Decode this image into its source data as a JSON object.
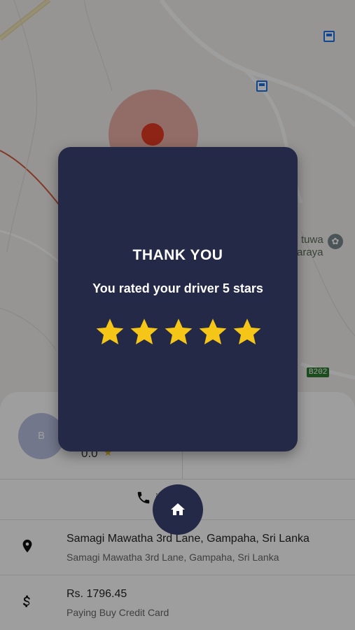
{
  "map": {
    "labels": [
      "tuwa",
      "araya"
    ],
    "road_shield": "B202",
    "accent_color": "#e63a22"
  },
  "driver": {
    "avatar_initial": "B",
    "rating": "0.0"
  },
  "call": {
    "label": "iver"
  },
  "trip": {
    "address_title": "Samagi Mawatha 3rd Lane, Gampaha, Sri Lanka",
    "address_subtitle": "Samagi Mawatha 3rd Lane, Gampaha, Sri Lanka",
    "fare": "Rs. 1796.45",
    "payment_method": "Paying Buy Credit Card"
  },
  "dialog": {
    "title": "THANK YOU",
    "message": "You rated your driver 5 stars",
    "stars": 5,
    "star_color": "#f5c518",
    "background": "#232946"
  },
  "home_button": {
    "icon": "home-icon"
  }
}
